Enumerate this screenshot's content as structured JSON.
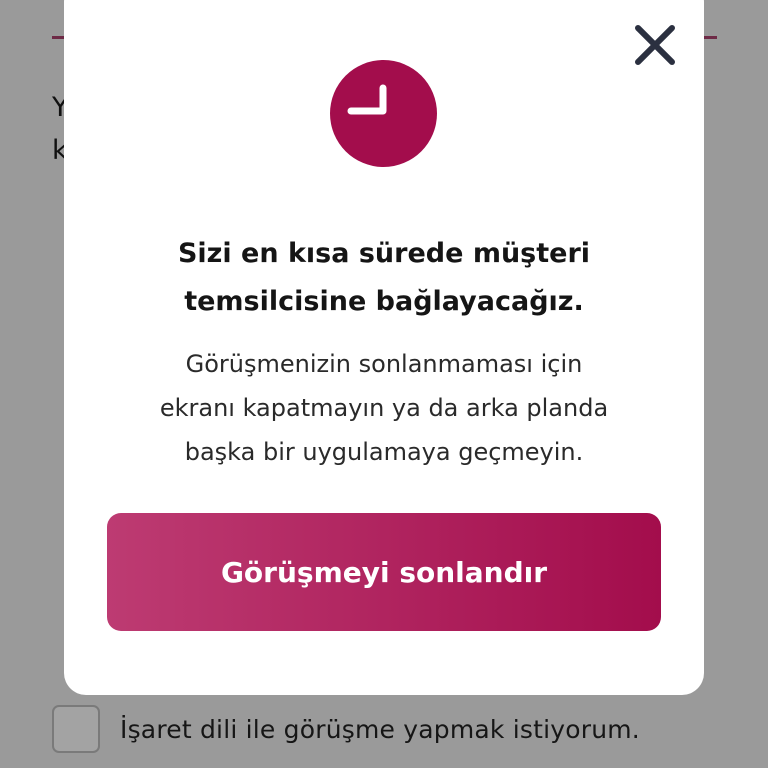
{
  "background": {
    "line1": "Y",
    "line2": "k",
    "checkbox_label": "İşaret dili ile görüşme yapmak istiyorum.",
    "checkbox_checked": false
  },
  "modal": {
    "close_icon": "close-icon",
    "status_icon": "clock-icon",
    "title_line1": "Sizi en kısa sürede müşteri",
    "title_line2": "temsilcisine bağlayacağız.",
    "body_line1": "Görüşmenizin sonlanmaması için",
    "body_line2": "ekranı kapatmayın ya da arka planda",
    "body_line3": "başka bir uygulamaya geçmeyin.",
    "end_button_label": "Görüşmeyi sonlandır"
  },
  "colors": {
    "accent": "#a30d4c",
    "accent_light": "#bd3b72",
    "overlay": "#9a9a9a",
    "close_icon": "#2b3040"
  }
}
